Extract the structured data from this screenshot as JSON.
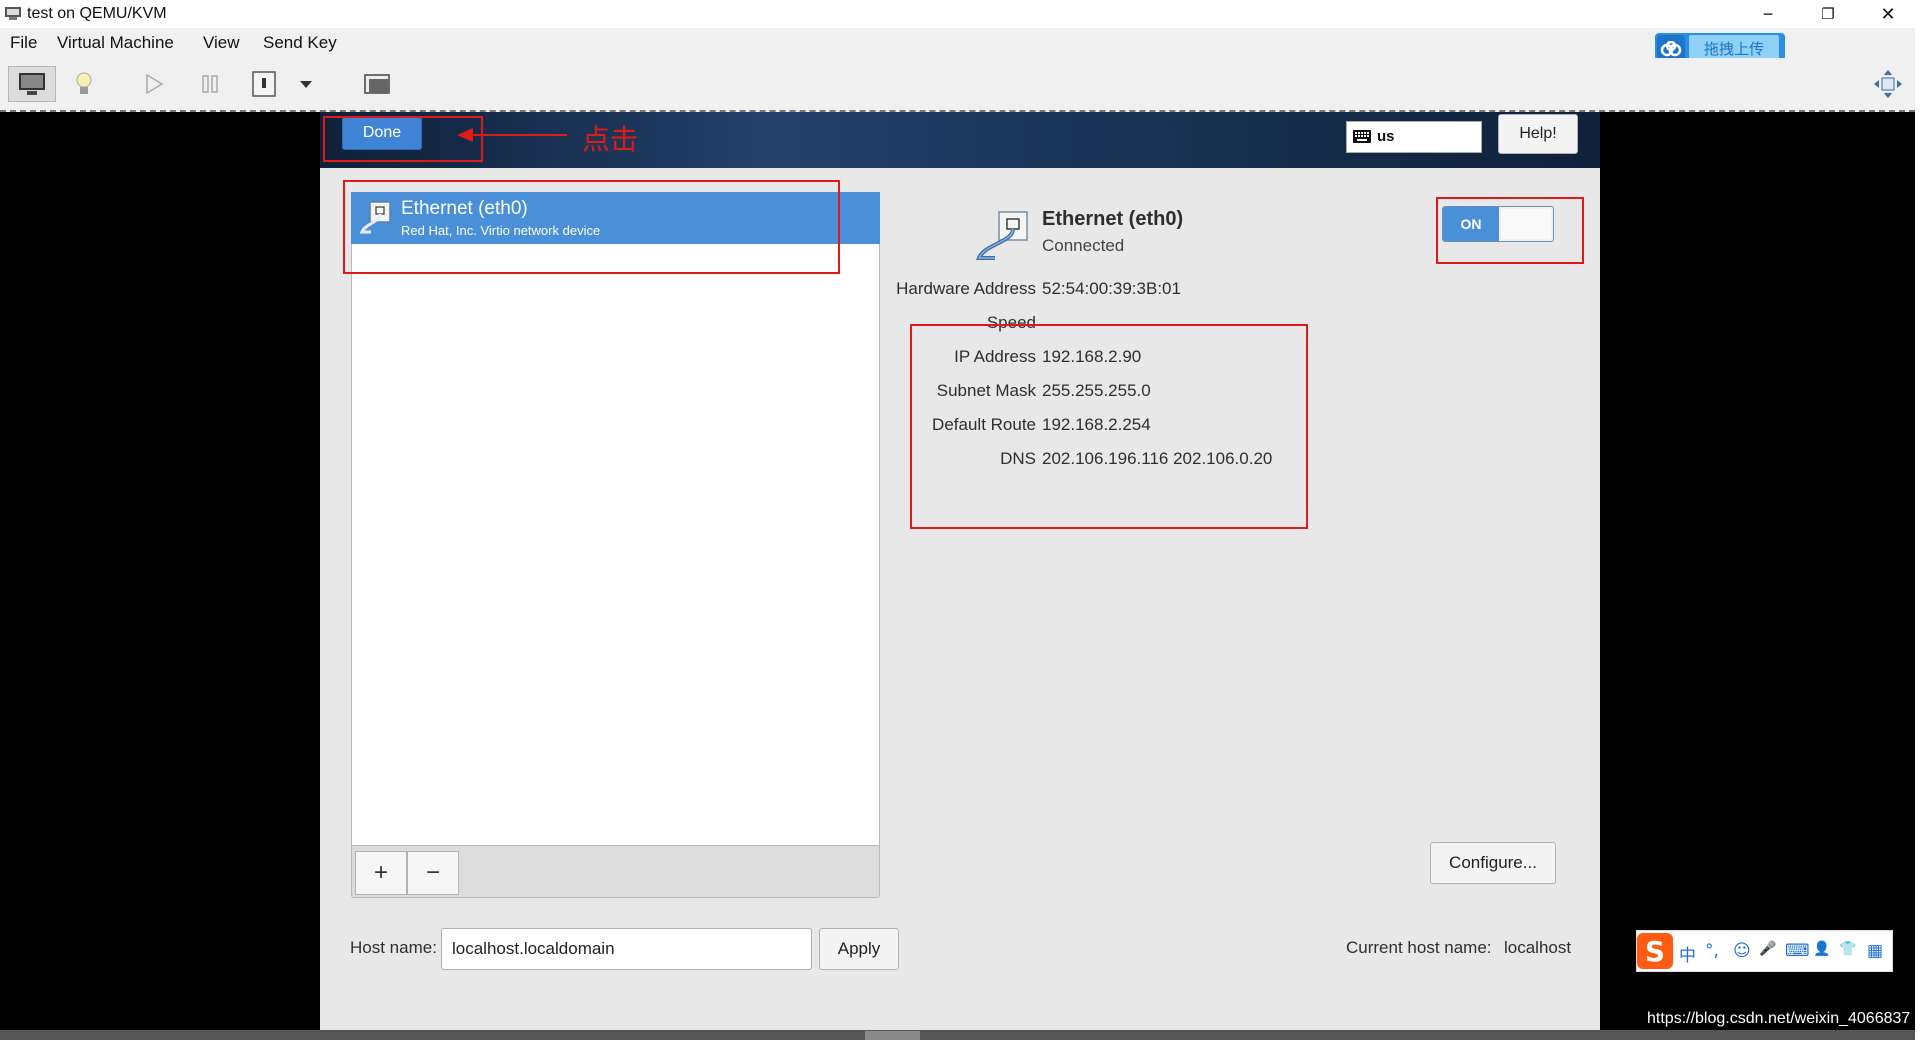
{
  "window": {
    "title": "test on QEMU/KVM",
    "controls": {
      "minimize": "−",
      "restore": "❐",
      "close": "✕"
    }
  },
  "menubar": {
    "items": [
      "File",
      "Virtual Machine",
      "View",
      "Send Key"
    ]
  },
  "upload_widget": {
    "label": "拖拽上传"
  },
  "toolbar": {
    "icons": [
      "monitor-icon",
      "lightbulb-icon",
      "play-icon",
      "pause-icon",
      "power-icon",
      "dropdown-arrow-icon",
      "screenshot-icon",
      "fullscreen-icon"
    ]
  },
  "installer": {
    "done_label": "Done",
    "keyboard_layout": "us",
    "help_label": "Help!",
    "devices": [
      {
        "name": "Ethernet (eth0)",
        "description": "Red Hat, Inc. Virtio network device"
      }
    ],
    "add_label": "+",
    "remove_label": "−",
    "details": {
      "title": "Ethernet (eth0)",
      "status": "Connected",
      "rows": [
        {
          "label": "Hardware Address",
          "value": "52:54:00:39:3B:01"
        },
        {
          "label": "Speed",
          "value": ""
        },
        {
          "label": "IP Address",
          "value": "192.168.2.90"
        },
        {
          "label": "Subnet Mask",
          "value": "255.255.255.0"
        },
        {
          "label": "Default Route",
          "value": "192.168.2.254"
        },
        {
          "label": "DNS",
          "value": "202.106.196.116 202.106.0.20"
        }
      ]
    },
    "toggle_label": "ON",
    "configure_label": "Configure...",
    "hostname_label": "Host name:",
    "hostname_value": "localhost.localdomain",
    "apply_label": "Apply",
    "current_hostname_label": "Current host name:",
    "current_hostname_value": "localhost"
  },
  "annotation": {
    "note": "点击",
    "color": "#e01919"
  },
  "ime": {
    "logo": "S",
    "icons": [
      "中",
      "°,",
      "☺",
      "🎤",
      "⌨",
      "👤",
      "👕",
      "▦"
    ]
  },
  "watermark": "https://blog.csdn.net/weixin_4066837",
  "colors": {
    "accent": "#4a90d9",
    "annotation": "#e01919"
  }
}
